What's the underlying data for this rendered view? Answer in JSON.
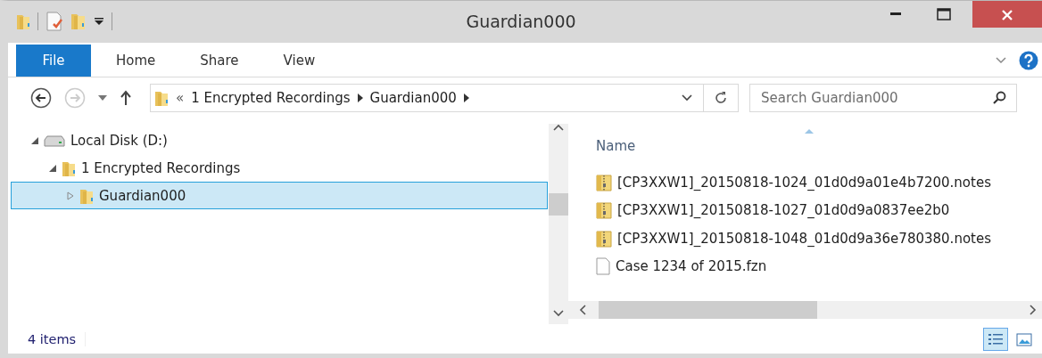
{
  "window": {
    "title": "Guardian000"
  },
  "ribbon_tabs": [
    {
      "label": "File",
      "selected": true
    },
    {
      "label": "Home",
      "selected": false
    },
    {
      "label": "Share",
      "selected": false
    },
    {
      "label": "View",
      "selected": false
    }
  ],
  "address_bar": {
    "overflow": "«",
    "segments": [
      "1 Encrypted Recordings",
      "Guardian000"
    ]
  },
  "search": {
    "placeholder": "Search Guardian000"
  },
  "navigation_tree": [
    {
      "label": "Local Disk (D:)",
      "kind": "drive",
      "expanded": true,
      "selected": false,
      "children": [
        {
          "label": "1 Encrypted Recordings",
          "kind": "folder",
          "expanded": true,
          "selected": false,
          "children": [
            {
              "label": "Guardian000",
              "kind": "folder",
              "expanded": false,
              "selected": true
            }
          ]
        }
      ]
    }
  ],
  "file_list": {
    "columns": [
      "Name"
    ],
    "rows": [
      {
        "name": "[CP3XXW1]_20150818-1024_01d0d9a01e4b7200.notes",
        "kind": "zip-folder"
      },
      {
        "name": "[CP3XXW1]_20150818-1027_01d0d9a0837ee2b0",
        "kind": "zip-folder"
      },
      {
        "name": "[CP3XXW1]_20150818-1048_01d0d9a36e780380.notes",
        "kind": "zip-folder"
      },
      {
        "name": "Case 1234 of 2015.fzn",
        "kind": "file"
      }
    ]
  },
  "status_bar": {
    "item_count": "4 items",
    "views": [
      {
        "kind": "details",
        "selected": true
      },
      {
        "kind": "large-icons",
        "selected": false
      }
    ]
  }
}
